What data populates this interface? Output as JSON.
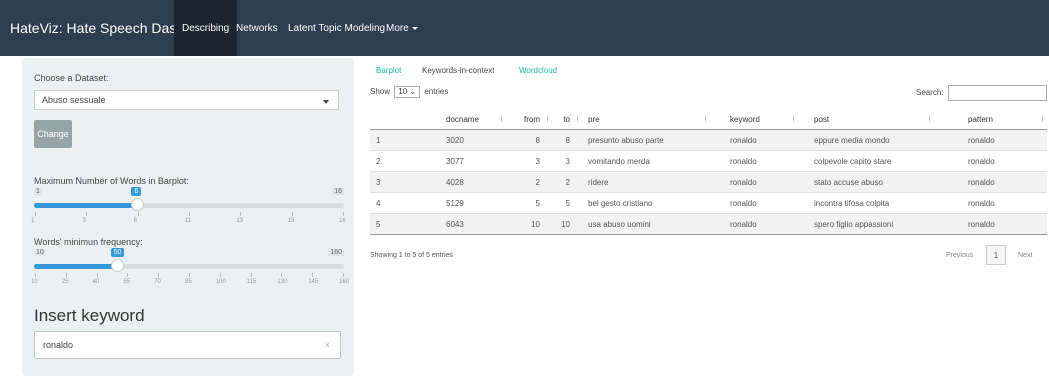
{
  "navbar": {
    "brand": "HateViz: Hate Speech Dashboard",
    "items": [
      {
        "label": "Describing",
        "active": true
      },
      {
        "label": "Networks",
        "active": false
      },
      {
        "label": "Latent Topic Modeling",
        "active": false
      },
      {
        "label": "More",
        "active": false,
        "dropdown": true
      }
    ]
  },
  "sidebar": {
    "dataset_label": "Choose a Dataset:",
    "dataset_value": "Abuso sessuale",
    "change_button": "Change",
    "slider1": {
      "label": "Maximum Number of Words in Barplot:",
      "min": 1,
      "max": 16,
      "value": 6,
      "min_label": "1",
      "max_label": "16",
      "value_label": "6",
      "ticks": [
        "1",
        "3",
        "6",
        "11",
        "13",
        "15",
        "16"
      ]
    },
    "slider2": {
      "label": "Words' minimun frequency:",
      "min": 10,
      "max": 160,
      "value": 50,
      "min_label": "10",
      "max_label": "160",
      "value_label": "50",
      "ticks": [
        "10",
        "25",
        "40",
        "55",
        "70",
        "85",
        "100",
        "115",
        "130",
        "145",
        "160"
      ]
    },
    "insert_title": "Insert keyword",
    "keyword_value": "ronaldo",
    "clear_glyph": "×"
  },
  "main": {
    "tabs": [
      {
        "label": "Barplot",
        "active": false
      },
      {
        "label": "Keywords-in-context",
        "active": true
      },
      {
        "label": "Wordcloud",
        "active": false
      }
    ],
    "show_prefix": "Show",
    "show_value": "10",
    "show_suffix": "entries",
    "search_label": "Search:",
    "table": {
      "headers": [
        "",
        "docname",
        "from",
        "to",
        "pre",
        "keyword",
        "post",
        "pattern"
      ],
      "rows": [
        [
          "1",
          "3020",
          "8",
          "8",
          "presunto abuso parte",
          "ronaldo",
          "eppure media mondo",
          "ronaldo"
        ],
        [
          "2",
          "3077",
          "3",
          "3",
          "vomitando merda",
          "ronaldo",
          "colpevole capito stare",
          "ronaldo"
        ],
        [
          "3",
          "4028",
          "2",
          "2",
          "ridere",
          "ronaldo",
          "stato accuse abuso",
          "ronaldo"
        ],
        [
          "4",
          "5129",
          "5",
          "5",
          "bel gesto cristiano",
          "ronaldo",
          "incontra tifosa colpita",
          "ronaldo"
        ],
        [
          "5",
          "6043",
          "10",
          "10",
          "usa abuso uomini",
          "ronaldo",
          "spero figlio appassioni",
          "ronaldo"
        ]
      ]
    },
    "info": "Showing 1 to 5 of 5 entries",
    "pagination": {
      "previous": "Previous",
      "current": "1",
      "next": "Next"
    }
  }
}
